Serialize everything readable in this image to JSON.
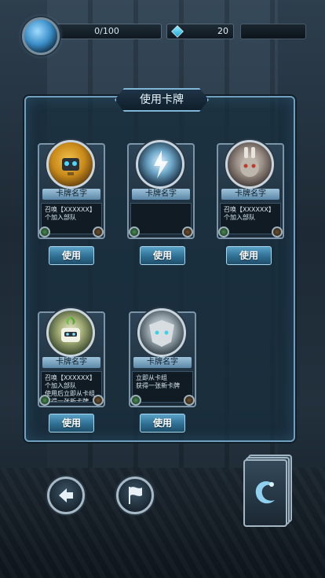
{
  "hud": {
    "energy_text": "0/100",
    "gem_count": "20",
    "icons": {
      "orb": "energy-orb-icon",
      "gem": "gem-icon"
    }
  },
  "panel": {
    "title": "使用卡牌"
  },
  "cards": [
    {
      "name": "卡牌名字",
      "description": "召唤【XXXXXX】\n个加入部队",
      "use_label": "使用",
      "portrait": "yellow-robot-portrait"
    },
    {
      "name": "卡牌名字",
      "description": "",
      "use_label": "使用",
      "portrait": "lightning-orb-portrait"
    },
    {
      "name": "卡牌名字",
      "description": "召唤【XXXXXX】\n个加入部队",
      "use_label": "使用",
      "portrait": "armored-rabbit-portrait"
    },
    {
      "name": "卡牌名字",
      "description": "召唤【XXXXXX】\n个加入部队\n使用后立即从卡组\n获得一张新卡牌",
      "use_label": "使用",
      "portrait": "sprout-robot-portrait"
    },
    {
      "name": "卡牌名字",
      "description": "立即从卡组\n获得一张新卡牌",
      "use_label": "使用",
      "portrait": "silver-beast-portrait"
    }
  ],
  "controls": {
    "back_icon": "arrow-left-icon",
    "flag_icon": "flag-icon",
    "deck_icon": "dragon-emblem-icon"
  },
  "colors": {
    "accent": "#7fb6d6",
    "button": "#2f6f93"
  }
}
